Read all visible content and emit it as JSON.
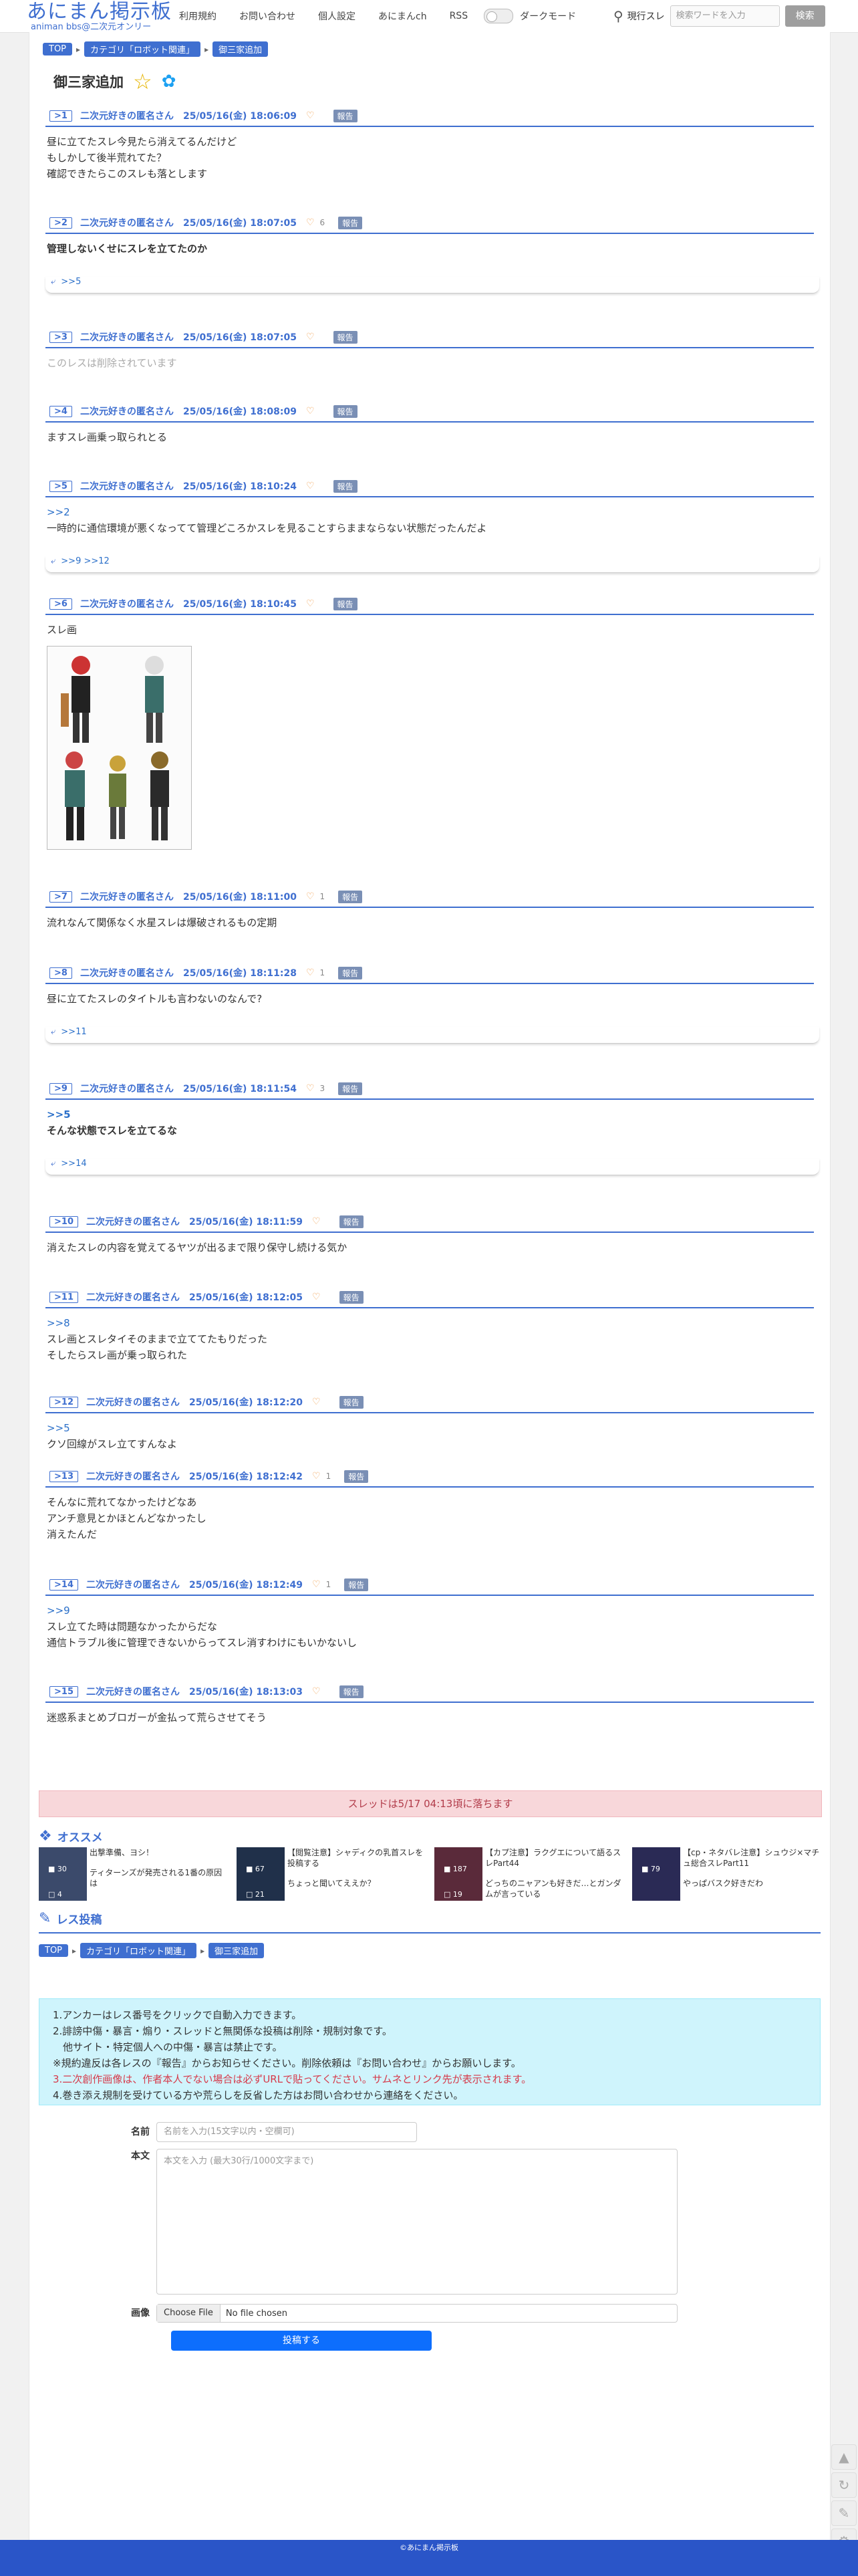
{
  "header": {
    "logo_main": "あにまん掲示板",
    "logo_sub": "animan bbs@二次元オンリー",
    "nav": [
      "利用規約",
      "お問い合わせ",
      "個人設定",
      "あにまんch",
      "RSS"
    ],
    "dark_mode_label": "ダークモード",
    "search_scope": "現行スレ",
    "search_placeholder": "検索ワードを入力",
    "search_button": "検索"
  },
  "breadcrumb": {
    "top": "TOP",
    "category": "カテゴリ「ロボット関連」",
    "thread": "御三家追加"
  },
  "thread_title": "御三家追加",
  "report_label": "報告",
  "posts": [
    {
      "num": "1",
      "name": "二次元好きの匿名さん",
      "date": "25/05/16(金) 18:06:09",
      "likes": "",
      "lines": [
        "昼に立てたスレ今見たら消えてるんだけど",
        "もしかして後半荒れてた？",
        "確認できたらこのスレも落とします"
      ],
      "backlinks": ""
    },
    {
      "num": "2",
      "name": "二次元好きの匿名さん",
      "date": "25/05/16(金) 18:07:05",
      "likes": "6",
      "lines": [
        "管理しないくせにスレを立てたのか"
      ],
      "backlinks": ">>5"
    },
    {
      "num": "3",
      "name": "二次元好きの匿名さん",
      "date": "25/05/16(金) 18:07:05",
      "likes": "",
      "lines": [
        "このレスは削除されています"
      ],
      "backlinks": ""
    },
    {
      "num": "4",
      "name": "二次元好きの匿名さん",
      "date": "25/05/16(金) 18:08:09",
      "likes": "",
      "lines": [
        "ますスレ画乗っ取られとる"
      ],
      "backlinks": ""
    },
    {
      "num": "5",
      "name": "二次元好きの匿名さん",
      "date": "25/05/16(金) 18:10:24",
      "likes": "",
      "ref": ">>2",
      "lines": [
        "一時的に通信環境が悪くなってて管理どころかスレを見ることすらままならない状態だったんだよ"
      ],
      "backlinks": ">>9 >>12"
    },
    {
      "num": "6",
      "name": "二次元好きの匿名さん",
      "date": "25/05/16(金) 18:10:45",
      "likes": "",
      "lines": [
        "スレ画"
      ],
      "backlinks": ""
    },
    {
      "num": "7",
      "name": "二次元好きの匿名さん",
      "date": "25/05/16(金) 18:11:00",
      "likes": "1",
      "lines": [
        "流れなんて関係なく水星スレは爆破されるもの定期"
      ],
      "backlinks": ""
    },
    {
      "num": "8",
      "name": "二次元好きの匿名さん",
      "date": "25/05/16(金) 18:11:28",
      "likes": "1",
      "lines": [
        "昼に立てたスレのタイトルも言わないのなんで?"
      ],
      "backlinks": ">>11"
    },
    {
      "num": "9",
      "name": "二次元好きの匿名さん",
      "date": "25/05/16(金) 18:11:54",
      "likes": "3",
      "ref": ">>5",
      "lines": [
        "そんな状態でスレを立てるな"
      ],
      "backlinks": ">>14"
    },
    {
      "num": "10",
      "name": "二次元好きの匿名さん",
      "date": "25/05/16(金) 18:11:59",
      "likes": "",
      "lines": [
        "消えたスレの内容を覚えてるヤツが出るまで限り保守し続ける気か"
      ],
      "backlinks": ""
    },
    {
      "num": "11",
      "name": "二次元好きの匿名さん",
      "date": "25/05/16(金) 18:12:05",
      "likes": "",
      "ref": ">>8",
      "lines": [
        "スレ画とスレタイそのままで立ててたもりだった",
        "そしたらスレ画が乗っ取られた"
      ],
      "backlinks": ""
    },
    {
      "num": "12",
      "name": "二次元好きの匿名さん",
      "date": "25/05/16(金) 18:12:20",
      "likes": "",
      "ref": ">>5",
      "lines": [
        "クソ回線がスレ立てすんなよ"
      ],
      "backlinks": ""
    },
    {
      "num": "13",
      "name": "二次元好きの匿名さん",
      "date": "25/05/16(金) 18:12:42",
      "likes": "1",
      "lines": [
        "そんなに荒れてなかったけどなあ",
        "アンチ意見とかほとんどなかったし",
        "消えたんだ"
      ],
      "backlinks": ""
    },
    {
      "num": "14",
      "name": "二次元好きの匿名さん",
      "date": "25/05/16(金) 18:12:49",
      "likes": "1",
      "ref": ">>9",
      "lines": [
        "スレ立てた時は問題なかったからだな",
        "通信トラブル後に管理できないからってスレ消すわけにもいかないし"
      ],
      "backlinks": ""
    },
    {
      "num": "15",
      "name": "二次元好きの匿名さん",
      "date": "25/05/16(金) 18:13:03",
      "likes": "",
      "lines": [
        "迷惑系まとめブロガーが金払って荒らさせてそう"
      ],
      "backlinks": ""
    }
  ],
  "thread_end_notice": "スレッドは5/17 04:13頃に落ちます",
  "recommend": {
    "heading": "オススメ",
    "items": [
      {
        "views": "30",
        "comments": "4",
        "title": "出撃準備、ヨシ！",
        "sub": "ティターンズが発売される1番の原因は"
      },
      {
        "views": "67",
        "comments": "21",
        "title": "【閲覧注意】シャディクの乳首スレを投稿する",
        "sub": "ちょっと聞いてええか？"
      },
      {
        "views": "187",
        "comments": "19",
        "title": "【カプ注意】ラクグエについて語るスレPart44",
        "sub": "どっちのニャアンも好きだ…とガンダムが言っている"
      },
      {
        "views": "79",
        "comments": "",
        "title": "【cp・ネタバレ注意】シュウジ×マチュ総合スレPart11",
        "sub": "やっぱバスク好きだわ"
      }
    ]
  },
  "reply": {
    "heading": "レス投稿",
    "rules": [
      {
        "text": "1.アンカーはレス番号をクリックで自動入力できます。",
        "red": false
      },
      {
        "text": "2.誹謗中傷・暴言・煽り・スレッドと無関係な投稿は削除・規制対象です。",
        "red": false
      },
      {
        "text": "　他サイト・特定個人への中傷・暴言は禁止です。",
        "red": false
      },
      {
        "text": "※規約違反は各レスの『報告』からお知らせください。削除依頼は『お問い合わせ』からお願いします。",
        "red": false
      },
      {
        "text": "3.二次創作画像は、作者本人でない場合は必ずURLで貼ってください。サムネとリンク先が表示されます。",
        "red": true
      },
      {
        "text": "4.巻き添え規制を受けている方や荒らしを反省した方はお問い合わせから連絡をください。",
        "red": false
      }
    ],
    "name_label": "名前",
    "name_placeholder": "名前を入力(15文字以内・空欄可)",
    "body_label": "本文",
    "body_placeholder": "本文を入力 (最大30行/1000文字まで)",
    "image_label": "画像",
    "file_button": "Choose File",
    "file_status": "No file chosen",
    "submit": "投稿する"
  },
  "footer": "©あにまん掲示板"
}
